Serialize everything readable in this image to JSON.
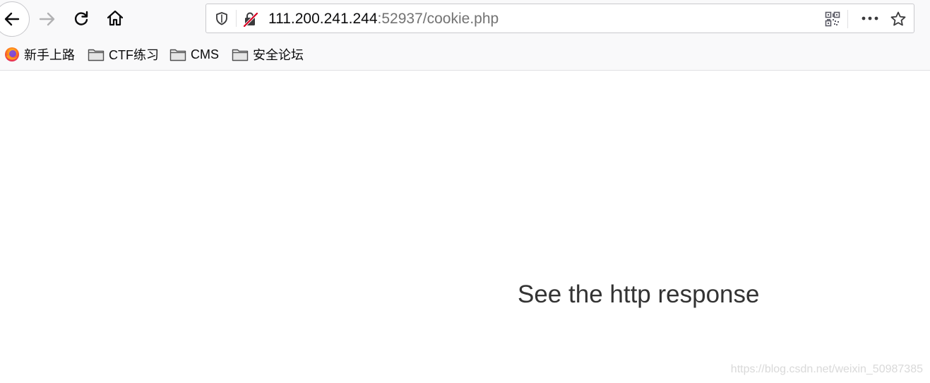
{
  "toolbar": {
    "url_host": "111.200.241.244",
    "url_rest": ":52937/cookie.php"
  },
  "bookmarks": [
    {
      "label": "新手上路",
      "icon": "firefox-icon"
    },
    {
      "label": "CTF练习",
      "icon": "folder-icon"
    },
    {
      "label": "CMS",
      "icon": "folder-icon"
    },
    {
      "label": "安全论坛",
      "icon": "folder-icon"
    }
  ],
  "page": {
    "message": "See the http response"
  },
  "watermark": "https://blog.csdn.net/weixin_50987385",
  "colors": {
    "toolbar_bg": "#f9f9fa",
    "insecure_red": "#d70022",
    "text_dark": "#333333"
  }
}
